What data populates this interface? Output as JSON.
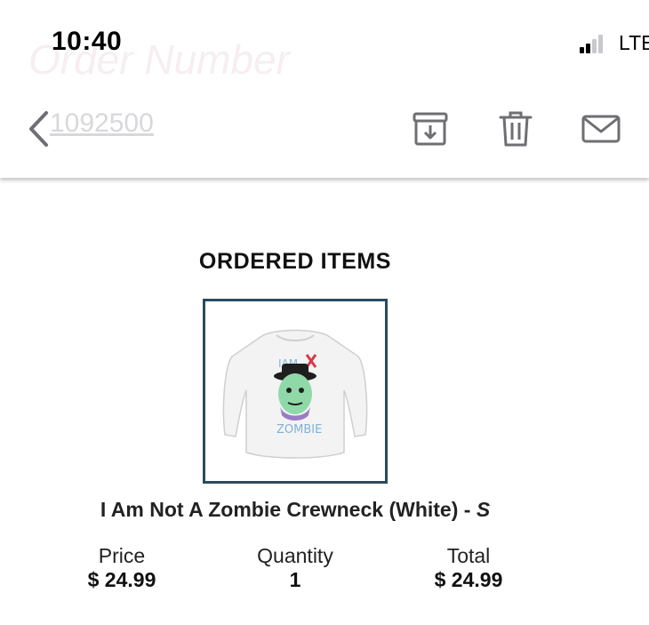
{
  "status_bar": {
    "time": "10:40",
    "carrier": "LTE",
    "signal_bars_filled": 2,
    "signal_bars_total": 4
  },
  "header": {
    "faded_title": "Order Number",
    "order_number": "1092500",
    "icons": [
      "back-chevron-icon",
      "archive-icon",
      "trash-icon",
      "mail-icon"
    ]
  },
  "ordered_items": {
    "title": "ORDERED ITEMS",
    "item": {
      "name": "I Am Not A Zombie Crewneck (White) - ",
      "size": "S",
      "price_label": "Price",
      "price": "$ 24.99",
      "quantity_label": "Quantity",
      "quantity": "1",
      "total_label": "Total",
      "total": "$ 24.99"
    }
  },
  "colors": {
    "image_border": "#2c4a5e",
    "icon_gray": "#6e6e73",
    "accent_green": "#8fd9a8",
    "accent_purple": "#9b7cc4",
    "accent_red": "#d83a4a",
    "text_dark": "#111111"
  }
}
